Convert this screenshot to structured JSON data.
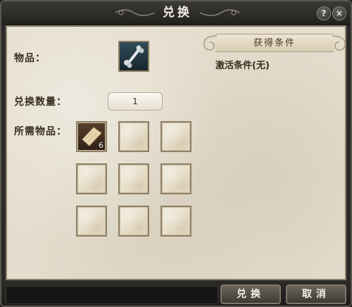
{
  "window": {
    "title": "兑换",
    "help_symbol": "?",
    "close_symbol": "×"
  },
  "form": {
    "item_label": "物品：",
    "quantity_label": "兑换数量：",
    "quantity_value": "1",
    "required_label": "所需物品："
  },
  "item": {
    "icon": "bone-icon"
  },
  "required_slots": [
    {
      "icon": "parchment-icon",
      "count": "6"
    },
    {
      "icon": "",
      "count": ""
    },
    {
      "icon": "",
      "count": ""
    },
    {
      "icon": "",
      "count": ""
    },
    {
      "icon": "",
      "count": ""
    },
    {
      "icon": "",
      "count": ""
    },
    {
      "icon": "",
      "count": ""
    },
    {
      "icon": "",
      "count": ""
    },
    {
      "icon": "",
      "count": ""
    }
  ],
  "condition_panel": {
    "banner": "获得条件",
    "text": "激活条件(无)"
  },
  "buttons": {
    "confirm": "兑换",
    "cancel": "取消"
  }
}
